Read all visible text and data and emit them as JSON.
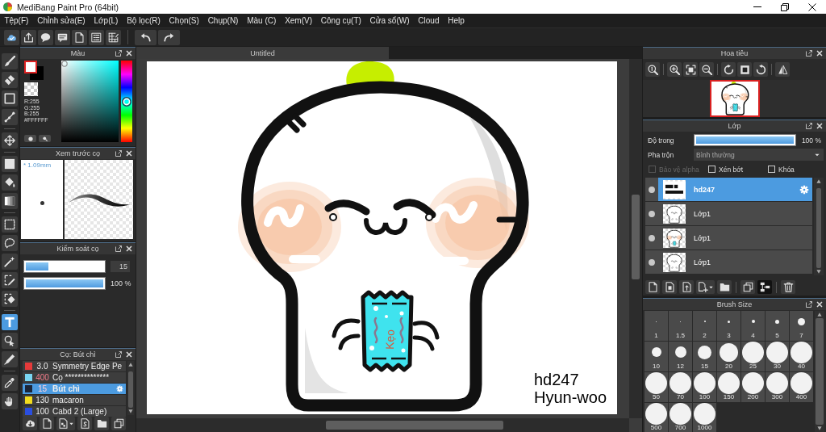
{
  "window": {
    "title": "MediBang Paint Pro (64bit)"
  },
  "menu": [
    "Tệp(F)",
    "Chỉnh sửa(E)",
    "Lớp(L)",
    "Bộ lọc(R)",
    "Chọn(S)",
    "Chụp(N)",
    "Màu (C)",
    "Xem(V)",
    "Công cụ(T)",
    "Cửa sổ(W)",
    "Cloud",
    "Help"
  ],
  "toolbar": [
    {
      "items": [
        {
          "kind": "cloud"
        },
        {
          "kind": "share"
        },
        {
          "kind": "bubble"
        },
        {
          "kind": "comment"
        },
        {
          "kind": "document"
        },
        {
          "kind": "list"
        },
        {
          "kind": "grid"
        }
      ]
    },
    {
      "items": [
        {
          "kind": "undo"
        },
        {
          "kind": "redo"
        }
      ]
    }
  ],
  "tools": [
    {
      "items": [
        {
          "kind": "brush",
          "selected": false
        },
        {
          "kind": "eraser",
          "selected": false
        },
        {
          "kind": "rect",
          "selected": false
        },
        {
          "kind": "polyline",
          "selected": false
        }
      ]
    },
    {
      "items": [
        {
          "kind": "move",
          "selected": false
        }
      ]
    },
    {
      "items": [
        {
          "kind": "fill",
          "selected": false
        },
        {
          "kind": "bucket",
          "selected": false
        },
        {
          "kind": "gradient",
          "selected": false
        }
      ]
    },
    {
      "items": [
        {
          "kind": "select",
          "selected": false
        },
        {
          "kind": "lasso",
          "selected": false
        },
        {
          "kind": "wand",
          "selected": false
        },
        {
          "kind": "selpen",
          "selected": false
        },
        {
          "kind": "selerase",
          "selected": false
        }
      ]
    },
    {
      "items": [
        {
          "kind": "text",
          "selected": true
        },
        {
          "kind": "operation",
          "selected": false
        },
        {
          "kind": "pen",
          "selected": false
        }
      ]
    },
    {
      "items": [
        {
          "kind": "dropper",
          "selected": false
        },
        {
          "kind": "hand",
          "selected": false
        }
      ]
    }
  ],
  "color_panel": {
    "title": "Màu",
    "readout": [
      "R:255",
      "G:255",
      "B:255",
      "#FFFFFF"
    ],
    "hue": {
      "level": 0.5
    }
  },
  "brush_preview": {
    "title": "Xem trước cọ",
    "size": "* 1.09mm"
  },
  "brush_control": {
    "title": "Kiểm soát cọ",
    "sliders": [
      {
        "kind": "boxed",
        "level": 0.29,
        "value": "15"
      },
      {
        "kind": "plain",
        "level": 1,
        "value": "100 %"
      }
    ]
  },
  "brush_list": {
    "title": "Cọ: Bút chì",
    "brushes": [
      {
        "size": "3.0",
        "name": "Symmetry Edge Pe",
        "color": "#e53a3a",
        "size_marked": false,
        "selected": false
      },
      {
        "size": "400",
        "name": "Cọ **************",
        "color": "#7ad6f2",
        "size_marked": true,
        "selected": false
      },
      {
        "size": "15",
        "name": "Bút chì",
        "color": "#1c2638",
        "size_marked": true,
        "selected": true
      },
      {
        "size": "130",
        "name": "macaron",
        "color": "#f2dc1e",
        "size_marked": false,
        "selected": false
      },
      {
        "size": "100",
        "name": "Cabd 2 (Large)",
        "color": "#2a4ee0",
        "size_marked": false,
        "selected": false
      }
    ],
    "tools": [
      {
        "kind": "clouddown"
      },
      {
        "kind": "document"
      },
      {
        "kind": "docmenu"
      },
      {
        "kind": "docs"
      },
      {
        "kind": "folder"
      },
      {
        "kind": "duplicate"
      }
    ]
  },
  "canvas": {
    "tab": "Untitled",
    "label": "Kẹo",
    "texts": [
      "hd247",
      "Hyun-woo"
    ]
  },
  "navigator": {
    "title": "Hoa tiêu",
    "tools": [
      {
        "items": [
          {
            "kind": "zoom1"
          }
        ]
      },
      {
        "items": [
          {
            "kind": "zoomin"
          },
          {
            "kind": "fit"
          },
          {
            "kind": "zoomout"
          }
        ]
      },
      {
        "items": [
          {
            "kind": "rotl"
          },
          {
            "kind": "frame"
          },
          {
            "kind": "rotr"
          }
        ]
      },
      {
        "items": [
          {
            "kind": "flip"
          }
        ]
      }
    ]
  },
  "layers_panel": {
    "title": "Lớp",
    "opacity": {
      "label": "Độ trong",
      "level": 1,
      "value": "100 %"
    },
    "blend": {
      "label": "Pha trộn",
      "value": "Bình thường"
    },
    "options": [
      {
        "label": "Bảo vệ alpha",
        "checked": false,
        "disabled": true
      },
      {
        "label": "Xén bớt",
        "checked": false,
        "disabled": false
      },
      {
        "label": "Khóa",
        "checked": false,
        "disabled": false
      }
    ],
    "layers": [
      {
        "name": "hd247",
        "kind": "text",
        "visible": true,
        "selected": true
      },
      {
        "name": "Lớp1",
        "kind": "outline",
        "visible": true,
        "selected": false
      },
      {
        "name": "Lớp1",
        "kind": "colored",
        "visible": true,
        "selected": false
      },
      {
        "name": "Lớp1",
        "kind": "outline",
        "visible": true,
        "selected": false
      }
    ],
    "tools": [
      {
        "items": [
          {
            "kind": "document",
            "selected": false
          },
          {
            "kind": "doc8",
            "selected": false
          },
          {
            "kind": "doc1",
            "selected": false
          },
          {
            "kind": "docadd",
            "selected": false
          },
          {
            "kind": "folder",
            "selected": false
          }
        ]
      },
      {
        "items": [
          {
            "kind": "duplicate",
            "selected": false
          },
          {
            "kind": "merge",
            "selected": true
          }
        ]
      },
      {
        "items": [
          {
            "kind": "trash",
            "selected": false
          }
        ]
      }
    ]
  },
  "brush_size": {
    "title": "Brush Size",
    "sizes": [
      "1",
      "1.5",
      "2",
      "3",
      "4",
      "5",
      "7",
      "10",
      "12",
      "15",
      "20",
      "25",
      "30",
      "40",
      "50",
      "70",
      "100",
      "150",
      "200",
      "300",
      "400",
      "500",
      "700",
      "1000"
    ]
  }
}
